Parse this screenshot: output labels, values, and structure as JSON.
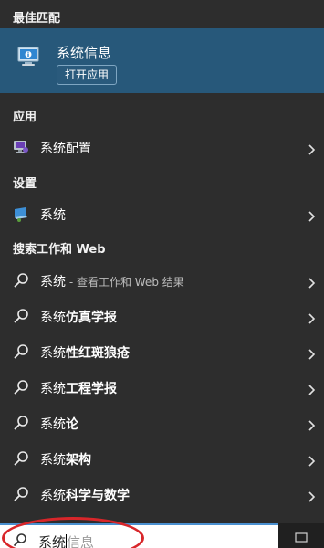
{
  "sections": {
    "best_match": "最佳匹配",
    "apps": "应用",
    "settings": "设置",
    "web": "搜索工作和 Web"
  },
  "best_match": {
    "app_name": "系统信息",
    "open_label": "打开应用"
  },
  "apps": [
    {
      "label": "系统配置",
      "icon": "system-config-icon"
    }
  ],
  "settings": [
    {
      "label": "系统",
      "icon": "system-settings-icon"
    }
  ],
  "web_results": [
    {
      "prefix": "系统",
      "suffix": "",
      "sub": " - 查看工作和 Web 结果"
    },
    {
      "prefix": "系统",
      "suffix": "仿真学报",
      "sub": ""
    },
    {
      "prefix": "系统",
      "suffix": "性红斑狼疮",
      "sub": ""
    },
    {
      "prefix": "系统",
      "suffix": "工程学报",
      "sub": ""
    },
    {
      "prefix": "系统",
      "suffix": "论",
      "sub": ""
    },
    {
      "prefix": "系统",
      "suffix": "架构",
      "sub": ""
    },
    {
      "prefix": "系统",
      "suffix": "科学与数学",
      "sub": ""
    }
  ],
  "search": {
    "typed": "系统",
    "suggestion": "信息"
  },
  "colors": {
    "panel_bg": "#2d2d2d",
    "selected_bg": "#27587a",
    "annotation": "#d8262a"
  }
}
